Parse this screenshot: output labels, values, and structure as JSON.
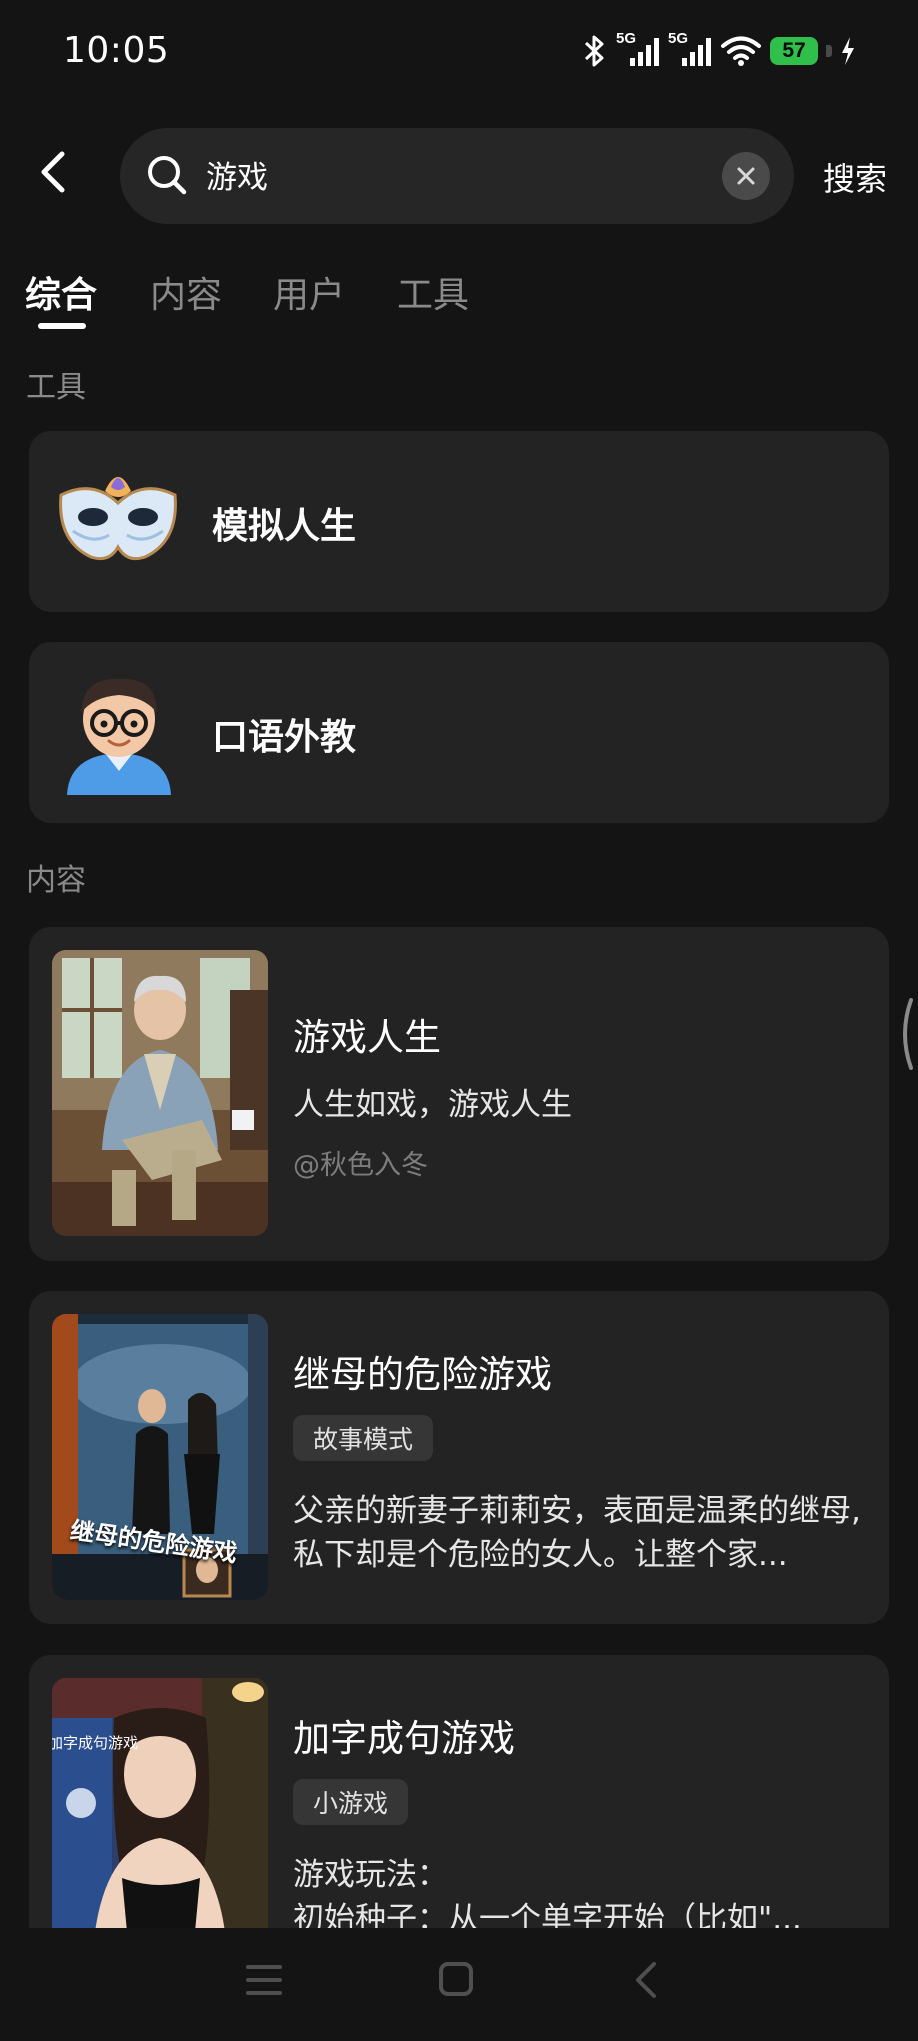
{
  "status_bar": {
    "time": "10:05",
    "signal_1_label": "5G",
    "signal_2_label": "5G",
    "battery": "57",
    "icons": [
      "bluetooth-icon",
      "signal-icon",
      "signal-icon",
      "wifi-icon",
      "battery-icon",
      "charging-icon"
    ]
  },
  "header": {
    "query": "游戏",
    "search_label": "搜索"
  },
  "tabs": [
    {
      "label": "综合",
      "active": true
    },
    {
      "label": "内容",
      "active": false
    },
    {
      "label": "用户",
      "active": false
    },
    {
      "label": "工具",
      "active": false
    }
  ],
  "tools_section": {
    "label": "工具",
    "items": [
      {
        "name": "模拟人生",
        "icon": "mask-icon"
      },
      {
        "name": "口语外教",
        "icon": "teacher-avatar-icon"
      }
    ]
  },
  "content_section": {
    "label": "内容",
    "items": [
      {
        "title": "游戏人生",
        "subtitle": "人生如戏，游戏人生",
        "author": "@秋色入冬"
      },
      {
        "title": "继母的危险游戏",
        "tag": "故事模式",
        "cover_text": "继母的危险游戏",
        "description": "父亲的新妻子莉莉安，表面是温柔的继母,私下却是个危险的女人。让整个家..."
      },
      {
        "title": "加字成句游戏",
        "tag": "小游戏",
        "cover_text": "加字成句游戏",
        "description_line1": "游戏玩法：",
        "description_line2": "初始种子：从一个单字开始（比如\"..."
      }
    ]
  },
  "colors": {
    "background": "#141414",
    "card": "#232323",
    "battery": "#2fbf4a"
  }
}
